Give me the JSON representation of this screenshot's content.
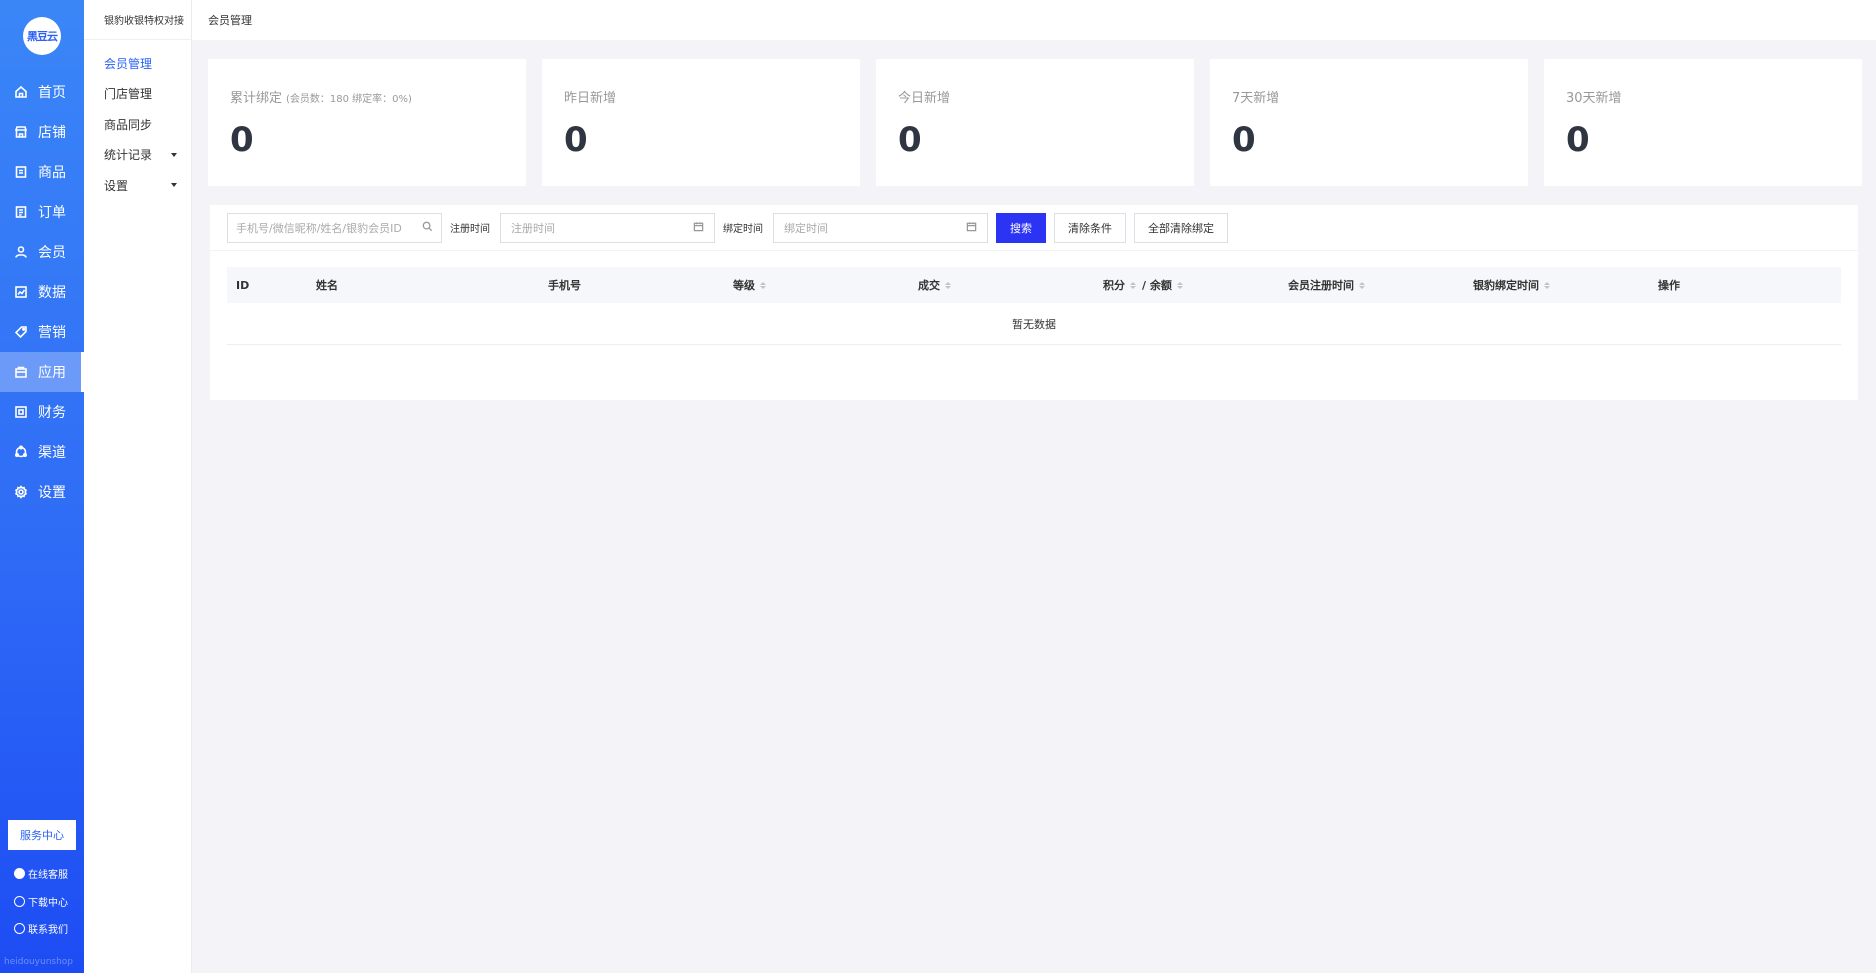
{
  "logo": {
    "text": "黑豆云"
  },
  "nav": [
    {
      "label": "首页",
      "icon": "home-icon"
    },
    {
      "label": "店铺",
      "icon": "store-icon"
    },
    {
      "label": "商品",
      "icon": "product-icon"
    },
    {
      "label": "订单",
      "icon": "order-icon"
    },
    {
      "label": "会员",
      "icon": "user-icon"
    },
    {
      "label": "数据",
      "icon": "chart-icon"
    },
    {
      "label": "营销",
      "icon": "tag-icon"
    },
    {
      "label": "应用",
      "icon": "app-icon"
    },
    {
      "label": "财务",
      "icon": "finance-icon"
    },
    {
      "label": "渠道",
      "icon": "channel-icon"
    },
    {
      "label": "设置",
      "icon": "gear-icon"
    }
  ],
  "nav_active": "应用",
  "service_center": "服务中心",
  "footer_links": {
    "online_service": "在线客服",
    "download": "下载中心",
    "contact": "联系我们"
  },
  "brand": "heidouyunshop",
  "subnav": {
    "title": "银豹收银特权对接",
    "items": [
      {
        "label": "会员管理",
        "active": true,
        "has_caret": false
      },
      {
        "label": "门店管理",
        "active": false,
        "has_caret": false
      },
      {
        "label": "商品同步",
        "active": false,
        "has_caret": false
      },
      {
        "label": "统计记录",
        "active": false,
        "has_caret": true
      },
      {
        "label": "设置",
        "active": false,
        "has_caret": true
      }
    ]
  },
  "breadcrumb": "会员管理",
  "stats": [
    {
      "label": "累计绑定",
      "note": "(会员数：180 绑定率：0%)",
      "value": "0"
    },
    {
      "label": "昨日新增",
      "note": "",
      "value": "0"
    },
    {
      "label": "今日新增",
      "note": "",
      "value": "0"
    },
    {
      "label": "7天新增",
      "note": "",
      "value": "0"
    },
    {
      "label": "30天新增",
      "note": "",
      "value": "0"
    }
  ],
  "filters": {
    "search_placeholder": "手机号/微信昵称/姓名/银豹会员ID",
    "register_label": "注册时间",
    "register_placeholder": "注册时间",
    "bind_label": "绑定时间",
    "bind_placeholder": "绑定时间",
    "search_btn": "搜索",
    "clear_btn": "清除条件",
    "clear_all_btn": "全部清除绑定"
  },
  "table": {
    "columns": [
      {
        "label": "ID",
        "sortable": false
      },
      {
        "label": "姓名",
        "sortable": false
      },
      {
        "label": "手机号",
        "sortable": false
      },
      {
        "label": "等级",
        "sortable": true
      },
      {
        "label": "成交",
        "sortable": true
      },
      {
        "label": "积分",
        "sortable": true
      },
      {
        "label": "/ 余额",
        "sortable": true
      },
      {
        "label": "会员注册时间",
        "sortable": true
      },
      {
        "label": "银豹绑定时间",
        "sortable": true
      },
      {
        "label": "操作",
        "sortable": false
      }
    ],
    "empty_text": "暂无数据"
  },
  "colors": {
    "sidebar_top": "#3a86f7",
    "sidebar_bottom": "#1d4cf4",
    "primary_button": "#2b34f2",
    "active_subnav": "#2b62f5",
    "background": "#f3f3f8"
  }
}
